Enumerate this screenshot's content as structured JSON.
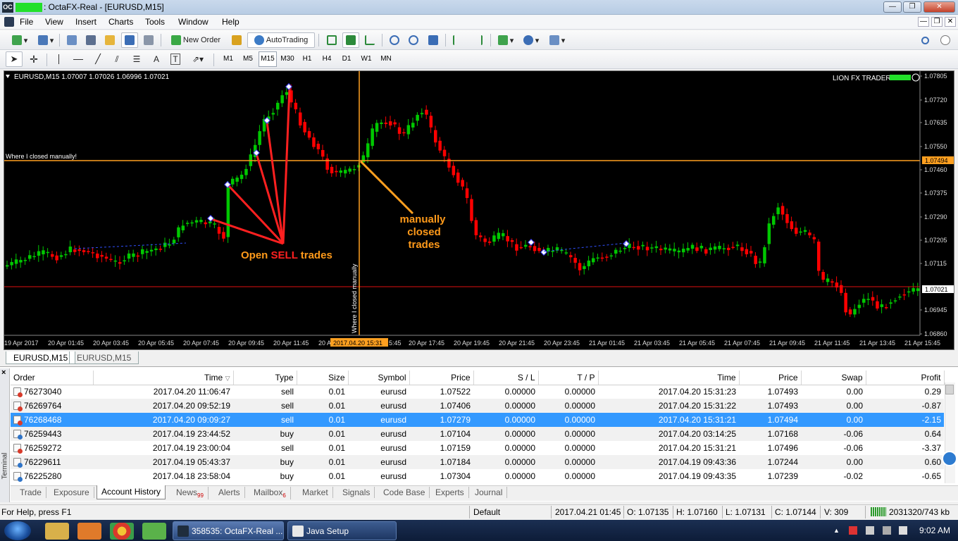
{
  "window": {
    "app_icon": "OC",
    "title": ": OctaFX-Real - [EURUSD,M15]",
    "controls": [
      "—",
      "❐",
      "✕"
    ],
    "mdi_controls": [
      "—",
      "❐",
      "✕"
    ]
  },
  "menu": [
    "File",
    "View",
    "Insert",
    "Charts",
    "Tools",
    "Window",
    "Help"
  ],
  "toolbar": {
    "new_order": "New Order",
    "autotrading": "AutoTrading",
    "timeframes": [
      "M1",
      "M5",
      "M15",
      "M30",
      "H1",
      "H4",
      "D1",
      "W1",
      "MN"
    ],
    "active_timeframe": "M15"
  },
  "chart": {
    "header": "EURUSD,M15  1.07007 1.07026 1.06996 1.07021",
    "ea_label": "LION FX TRADER-",
    "bg_color": "#000000",
    "bull_color": "#00c800",
    "bear_color": "#ff0000",
    "annotations": {
      "closed_line_label": "Where I closed manually!",
      "vertical_label": "Where I closed manually",
      "open_sell_prefix": "Open ",
      "open_sell_word": "SELL",
      "open_sell_suffix": " trades",
      "manual_line1": "manually",
      "manual_line2": "closed",
      "manual_line3": "trades"
    },
    "price_ticks": [
      "1.07805",
      "1.07720",
      "1.07635",
      "1.07550",
      "1.07460",
      "1.07375",
      "1.07290",
      "1.07205",
      "1.07115",
      "1.06945",
      "1.06860"
    ],
    "highlight_prices": [
      {
        "value": "1.07494",
        "style": "orange"
      },
      {
        "value": "1.07021",
        "style": "white"
      }
    ],
    "time_ticks": [
      "19 Apr 2017",
      "20 Apr 01:45",
      "20 Apr 03:45",
      "20 Apr 05:45",
      "20 Apr 07:45",
      "20 Apr 09:45",
      "20 Apr 11:45",
      "20 A",
      "5:45",
      "20 Apr 17:45",
      "20 Apr 19:45",
      "20 Apr 21:45",
      "20 Apr 23:45",
      "21 Apr 01:45",
      "21 Apr 03:45",
      "21 Apr 05:45",
      "21 Apr 07:45",
      "21 Apr 09:45",
      "21 Apr 11:45",
      "21 Apr 13:45",
      "21 Apr 15:45"
    ],
    "crosshair_time": "2017.04.20 15:31"
  },
  "chart_tabs": [
    "EURUSD,M15",
    "EURUSD,M15"
  ],
  "terminal": {
    "side_label": "Terminal",
    "close": "×",
    "columns": [
      "Order",
      "Time",
      "Type",
      "Size",
      "Symbol",
      "Price",
      "S / L",
      "T / P",
      "Time",
      "Price",
      "Swap",
      "Profit"
    ],
    "sort_indicator": "▽",
    "rows": [
      [
        "76273040",
        "2017.04.20 11:06:47",
        "sell",
        "0.01",
        "eurusd",
        "1.07522",
        "0.00000",
        "0.00000",
        "2017.04.20 15:31:23",
        "1.07493",
        "0.00",
        "0.29"
      ],
      [
        "76269764",
        "2017.04.20 09:52:19",
        "sell",
        "0.01",
        "eurusd",
        "1.07406",
        "0.00000",
        "0.00000",
        "2017.04.20 15:31:22",
        "1.07493",
        "0.00",
        "-0.87"
      ],
      [
        "76268468",
        "2017.04.20 09:09:27",
        "sell",
        "0.01",
        "eurusd",
        "1.07279",
        "0.00000",
        "0.00000",
        "2017.04.20 15:31:21",
        "1.07494",
        "0.00",
        "-2.15"
      ],
      [
        "76259443",
        "2017.04.19 23:44:52",
        "buy",
        "0.01",
        "eurusd",
        "1.07104",
        "0.00000",
        "0.00000",
        "2017.04.20 03:14:25",
        "1.07168",
        "-0.06",
        "0.64"
      ],
      [
        "76259272",
        "2017.04.19 23:00:04",
        "sell",
        "0.01",
        "eurusd",
        "1.07159",
        "0.00000",
        "0.00000",
        "2017.04.20 15:31:21",
        "1.07496",
        "-0.06",
        "-3.37"
      ],
      [
        "76229611",
        "2017.04.19 05:43:37",
        "buy",
        "0.01",
        "eurusd",
        "1.07184",
        "0.00000",
        "0.00000",
        "2017.04.19 09:43:36",
        "1.07244",
        "0.00",
        "0.60"
      ],
      [
        "76225280",
        "2017.04.18 23:58:04",
        "buy",
        "0.01",
        "eurusd",
        "1.07304",
        "0.00000",
        "0.00000",
        "2017.04.19 09:43:35",
        "1.07239",
        "-0.02",
        "-0.65"
      ]
    ],
    "selected_row": 2,
    "tabs": [
      {
        "label": "Trade",
        "badge": ""
      },
      {
        "label": "Exposure",
        "badge": ""
      },
      {
        "label": "Account History",
        "badge": ""
      },
      {
        "label": "News",
        "badge": "99"
      },
      {
        "label": "Alerts",
        "badge": ""
      },
      {
        "label": "Mailbox",
        "badge": "6"
      },
      {
        "label": "Market",
        "badge": ""
      },
      {
        "label": "Signals",
        "badge": ""
      },
      {
        "label": "Code Base",
        "badge": ""
      },
      {
        "label": "Experts",
        "badge": ""
      },
      {
        "label": "Journal",
        "badge": ""
      }
    ],
    "active_tab": "Account History"
  },
  "status": {
    "help": "For Help, press F1",
    "profile": "Default",
    "datetime": "2017.04.21 01:45",
    "open": "O: 1.07135",
    "high": "H: 1.07160",
    "low": "L: 1.07131",
    "close": "C: 1.07144",
    "volume": "V: 309",
    "traffic": "2031320/743 kb"
  },
  "taskbar": {
    "tasks": [
      "358535: OctaFX-Real ...",
      "Java Setup"
    ],
    "clock": "9:02 AM"
  }
}
